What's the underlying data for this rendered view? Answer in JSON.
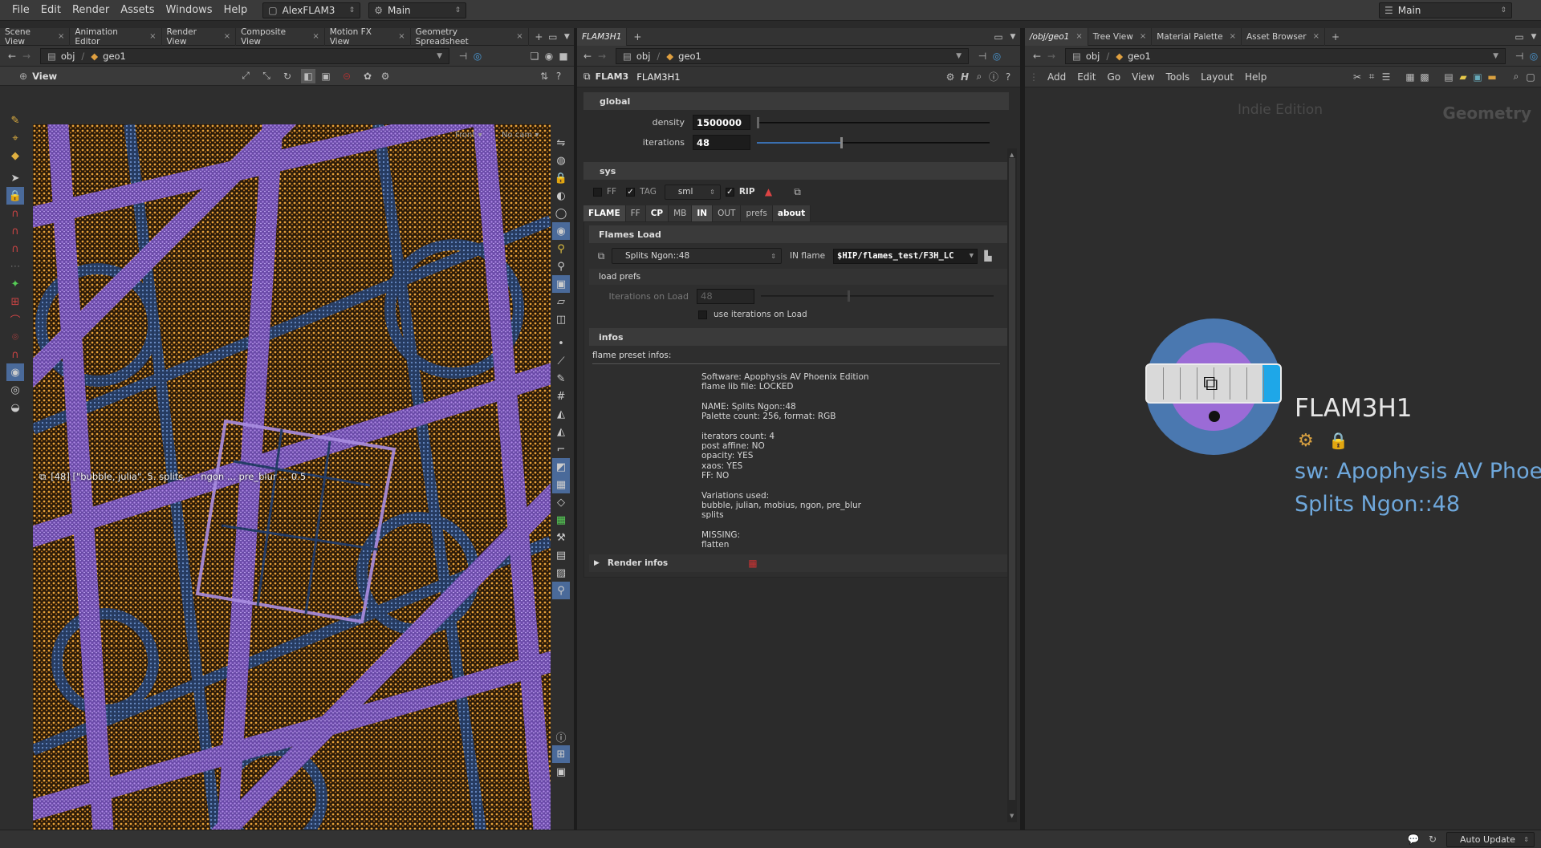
{
  "menubar": {
    "items": [
      "File",
      "Edit",
      "Render",
      "Assets",
      "Windows",
      "Help"
    ],
    "desktop": "AlexFLAM3",
    "context": "Main",
    "right_context": "Main"
  },
  "left_pane": {
    "tabs": [
      "Scene View",
      "Animation Editor",
      "Render View",
      "Composite View",
      "Motion FX View",
      "Geometry Spreadsheet"
    ],
    "path": [
      "obj",
      "geo1"
    ],
    "viewport_label": "View",
    "camera_menu": "Front",
    "cam_menu2": "No cam",
    "overlay_text": "[48] [\"bubble, julia\", 5. splits, ... ngon ... pre_blur ... 0.5"
  },
  "param_pane": {
    "tab": "FLAM3H1",
    "path": [
      "obj",
      "geo1"
    ],
    "node_type": "FLAM3",
    "node_name": "FLAM3H1",
    "global": {
      "title": "global",
      "density_label": "density",
      "density": "1500000",
      "iterations_label": "iterations",
      "iterations": "48",
      "iterations_frac": 0.36
    },
    "sys": {
      "title": "sys",
      "ff_label": "FF",
      "tag_label": "TAG",
      "size_menu": "sml",
      "rip_label": "RIP"
    },
    "tabs": [
      "FLAME",
      "FF",
      "CP",
      "MB",
      "IN",
      "OUT",
      "prefs",
      "about"
    ],
    "flames_load": {
      "title": "Flames Load",
      "preset": "Splits Ngon::48",
      "in_flame_label": "IN flame",
      "in_flame_path": "$HIP/flames_test/F3H_LC",
      "load_prefs": "load prefs",
      "iterations_on_load_label": "Iterations on Load",
      "iterations_on_load": "48",
      "use_iterations_label": "use iterations on Load"
    },
    "infos": {
      "title": "infos",
      "preset_infos_label": "flame preset infos:",
      "lines": [
        "Software: Apophysis AV Phoenix Edition",
        "flame lib file: LOCKED",
        "",
        "NAME: Splits Ngon::48",
        "Palette count: 256, format: RGB",
        "",
        "iterators count: 4",
        "post affine: NO",
        "opacity: YES",
        "xaos: YES",
        "FF: NO",
        "",
        "Variations used:",
        "bubble, julian, mobius, ngon, pre_blur",
        "splits",
        "",
        "MISSING:",
        "flatten"
      ],
      "render_infos": "Render infos"
    }
  },
  "network_pane": {
    "tabs": [
      "/obj/geo1",
      "Tree View",
      "Material Palette",
      "Asset Browser"
    ],
    "path": [
      "obj",
      "geo1"
    ],
    "menu": [
      "Add",
      "Edit",
      "Go",
      "View",
      "Tools",
      "Layout",
      "Help"
    ],
    "watermark": "Indie Edition",
    "context_label": "Geometry",
    "node": {
      "name": "FLAM3H1",
      "line1": "sw: Apophysis AV Phoe",
      "line2": "Splits Ngon::48"
    }
  },
  "status": {
    "auto_update": "Auto Update"
  },
  "colors": {
    "accent_blue": "#6fa8dc",
    "node_ring": "#4a78b0",
    "node_inner": "#9b6bd6",
    "node_body_accent": "#1ea7e8"
  }
}
